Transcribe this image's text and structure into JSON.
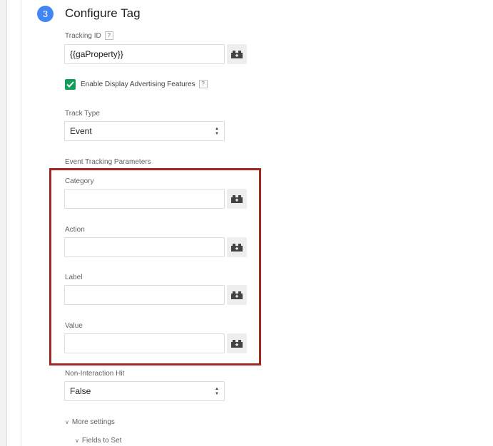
{
  "step": {
    "number": "3",
    "title": "Configure Tag"
  },
  "tracking_id": {
    "label": "Tracking ID",
    "help": "?",
    "value": "{{gaProperty}}"
  },
  "display_advertising": {
    "label": "Enable Display Advertising Features",
    "help": "?",
    "checked": true
  },
  "track_type": {
    "label": "Track Type",
    "selected": "Event"
  },
  "event_params": {
    "heading": "Event Tracking Parameters",
    "category": {
      "label": "Category",
      "value": ""
    },
    "action": {
      "label": "Action",
      "value": ""
    },
    "label_field": {
      "label": "Label",
      "value": ""
    },
    "value_field": {
      "label": "Value",
      "value": ""
    }
  },
  "non_interaction": {
    "label": "Non-Interaction Hit",
    "selected": "False"
  },
  "more_settings": {
    "label": "More settings",
    "fields_to_set": "Fields to Set"
  },
  "colors": {
    "badge": "#4285f4",
    "checkbox": "#0f9d58",
    "highlight": "#a2271e"
  },
  "icons": {
    "variable": "lego-brick-icon",
    "chevron": "chevron-down-icon",
    "select_caret": "select-arrows-icon"
  }
}
